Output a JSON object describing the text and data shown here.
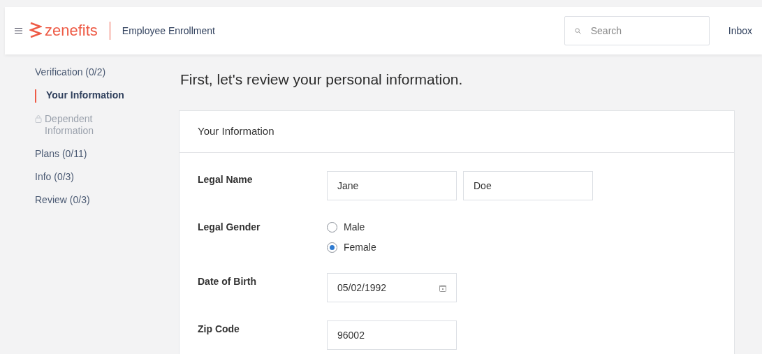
{
  "header": {
    "logo": "zenefits",
    "title": "Employee Enrollment",
    "search": {
      "placeholder": "Search"
    },
    "inbox": "Inbox"
  },
  "sidebar": {
    "items": [
      {
        "label": "Verification (0/2)",
        "selected": false,
        "locked": false,
        "children": [
          {
            "label": "Your Information",
            "selected": true,
            "locked": false
          },
          {
            "label": "Dependent Information",
            "selected": false,
            "locked": true
          }
        ]
      },
      {
        "label": "Plans (0/11)",
        "selected": false,
        "locked": false
      },
      {
        "label": "Info (0/3)",
        "selected": false,
        "locked": false
      },
      {
        "label": "Review (0/3)",
        "selected": false,
        "locked": false
      }
    ]
  },
  "heading": "First, let's review your personal information.",
  "card": {
    "title": "Your Information",
    "rows": [
      {
        "kind": "text",
        "label": "Legal Name",
        "values": [
          "Jane",
          "Doe"
        ]
      },
      {
        "kind": "radio",
        "label": "Legal Gender",
        "options": [
          {
            "label": "Male",
            "selected": false
          },
          {
            "label": "Female",
            "selected": true
          }
        ]
      },
      {
        "kind": "date",
        "label": "Date of Birth",
        "values": [
          "05/02/1992"
        ]
      },
      {
        "kind": "text",
        "label": "Zip Code",
        "values": [
          "96002"
        ]
      }
    ]
  }
}
